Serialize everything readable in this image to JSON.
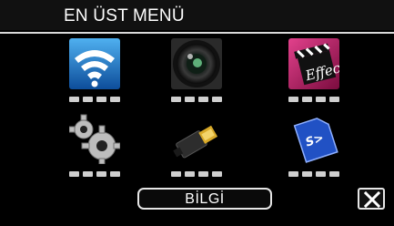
{
  "header": {
    "title": "EN ÜST MENÜ"
  },
  "menu": {
    "items": [
      {
        "icon": "wifi-icon"
      },
      {
        "icon": "camera-lens-icon"
      },
      {
        "icon": "effect-clapperboard-icon"
      },
      {
        "icon": "gear-settings-icon"
      },
      {
        "icon": "hdmi-connector-icon"
      },
      {
        "icon": "sd-card-icon"
      }
    ]
  },
  "footer": {
    "info_label": "BİLGİ",
    "close_icon": "close-icon"
  },
  "colors": {
    "background": "#000000",
    "title_bar": "#111111",
    "rule": "#d8d8d8",
    "button_border": "#e6e6e6",
    "wifi_tile": "#1a6fb8",
    "effect_tile": "#b0155c",
    "sd_tile": "#1c3f9a"
  }
}
